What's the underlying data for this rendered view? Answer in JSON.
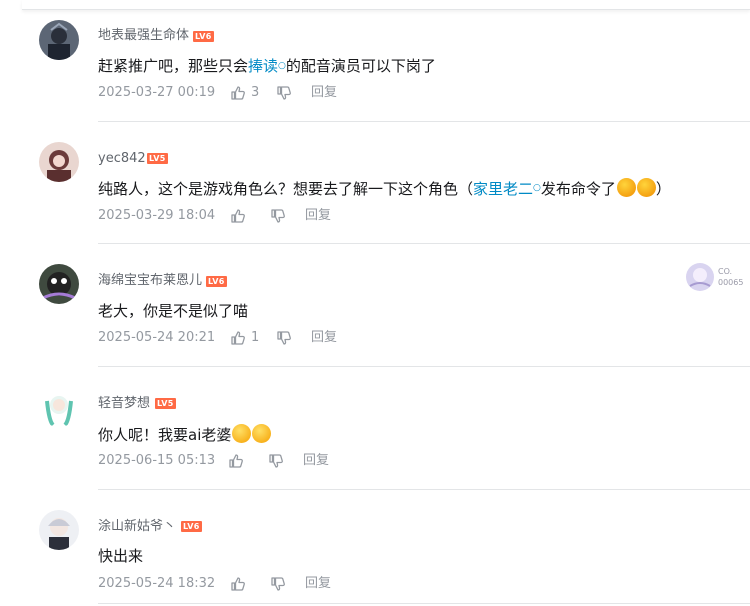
{
  "comments": [
    {
      "username": "地表最强生命体",
      "level": "LV6",
      "content_before": "赶紧推广吧，那些只会",
      "content_link": "捧读",
      "content_after": "的配音演员可以下岗了",
      "time": "2025-03-27 00:19",
      "likes": "3",
      "reply": "回复"
    },
    {
      "username": "yec842",
      "level": "LV5",
      "content_before": "纯路人，这个是游戏角色么？想要去了解一下这个角色（",
      "content_link": "家里老二",
      "content_after": "发布命令了",
      "content_tail": "）",
      "time": "2025-03-29 18:04",
      "likes": "",
      "reply": "回复"
    },
    {
      "username": "海绵宝宝布莱恩儿",
      "level": "LV6",
      "content": "老大，你是不是似了喵",
      "time": "2025-05-24 20:21",
      "likes": "1",
      "reply": "回复"
    },
    {
      "username": "轻音梦想",
      "level": "LV5",
      "content": "你人呢！我要ai老婆",
      "time": "2025-06-15 05:13",
      "likes": "",
      "reply": "回复"
    },
    {
      "username": "涂山新姑爷丶",
      "level": "LV6",
      "content": "快出来",
      "time": "2025-05-24 18:32",
      "likes": "",
      "reply": "回复"
    }
  ],
  "decor": {
    "card_text_1": "CO.",
    "card_text_2": "00065"
  },
  "icons": {
    "like": "thumb-up-icon",
    "dislike": "thumb-down-icon"
  },
  "colors": {
    "link": "#008ac5",
    "level_badge": "#ff6a45",
    "meta": "#9499a0"
  }
}
